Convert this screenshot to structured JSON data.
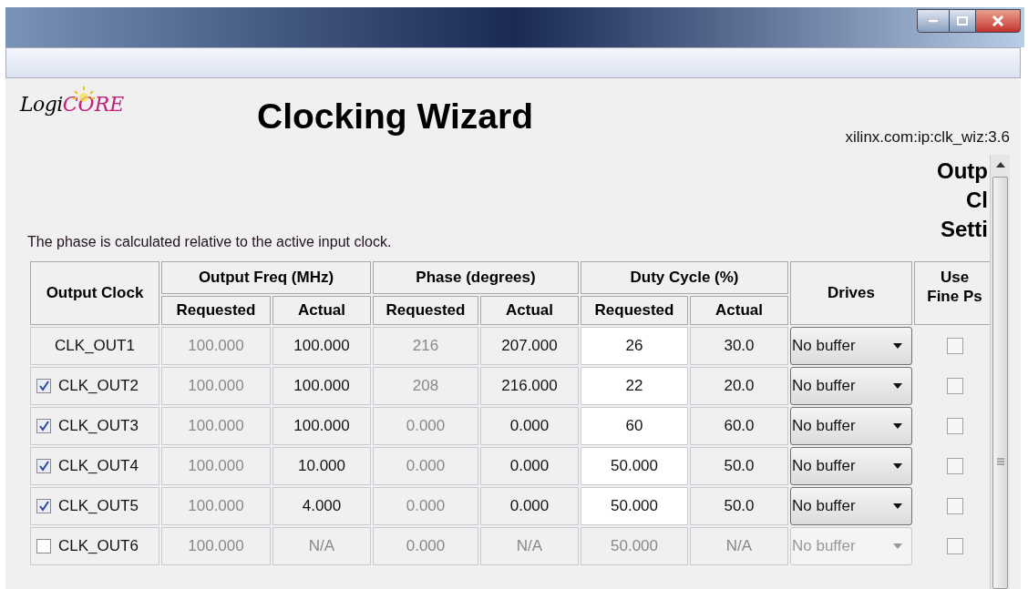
{
  "logo": {
    "part_1": "Logi",
    "part_2": "CORE"
  },
  "title": "Clocking Wizard",
  "ip_version": "xilinx.com:ip:clk_wiz:3.6",
  "side_heading": [
    "Outp",
    "Cl",
    "Setti"
  ],
  "note": "The phase is calculated relative to the active input clock.",
  "table": {
    "groups": [
      "Output Clock",
      "Output Freq (MHz)",
      "Phase (degrees)",
      "Duty Cycle (%)",
      "Drives",
      "Use\nFine Ps"
    ],
    "subcolumns": [
      "Requested",
      "Actual",
      "Requested",
      "Actual",
      "Requested",
      "Actual"
    ],
    "rows": [
      {
        "kind": "fixed",
        "clock": "CLK_OUT1",
        "enabled": true,
        "freq_requested": "100.000",
        "freq_actual": "100.000",
        "phase_requested": "216",
        "phase_actual": "207.000",
        "duty_requested": "26",
        "duty_actual": "30.0",
        "drives": "No buffer",
        "fine_ps": false
      },
      {
        "kind": "optional",
        "clock": "CLK_OUT2",
        "checked": true,
        "enabled": true,
        "freq_requested": "100.000",
        "freq_actual": "100.000",
        "phase_requested": "208",
        "phase_actual": "216.000",
        "duty_requested": "22",
        "duty_actual": "20.0",
        "drives": "No buffer",
        "fine_ps": false
      },
      {
        "kind": "optional",
        "clock": "CLK_OUT3",
        "checked": true,
        "enabled": true,
        "freq_requested": "100.000",
        "freq_actual": "100.000",
        "phase_requested": "0.000",
        "phase_actual": "0.000",
        "duty_requested": "60",
        "duty_actual": "60.0",
        "drives": "No buffer",
        "fine_ps": false
      },
      {
        "kind": "optional",
        "clock": "CLK_OUT4",
        "checked": true,
        "enabled": true,
        "freq_requested": "100.000",
        "freq_actual": "10.000",
        "phase_requested": "0.000",
        "phase_actual": "0.000",
        "duty_requested": "50.000",
        "duty_actual": "50.0",
        "drives": "No buffer",
        "fine_ps": false
      },
      {
        "kind": "optional",
        "clock": "CLK_OUT5",
        "checked": true,
        "enabled": true,
        "freq_requested": "100.000",
        "freq_actual": "4.000",
        "phase_requested": "0.000",
        "phase_actual": "0.000",
        "duty_requested": "50.000",
        "duty_actual": "50.0",
        "drives": "No buffer",
        "fine_ps": false
      },
      {
        "kind": "optional",
        "clock": "CLK_OUT6",
        "checked": false,
        "enabled": false,
        "freq_requested": "100.000",
        "freq_actual": "N/A",
        "phase_requested": "0.000",
        "phase_actual": "N/A",
        "duty_requested": "50.000",
        "duty_actual": "N/A",
        "drives": "No buffer",
        "fine_ps": false
      }
    ]
  }
}
